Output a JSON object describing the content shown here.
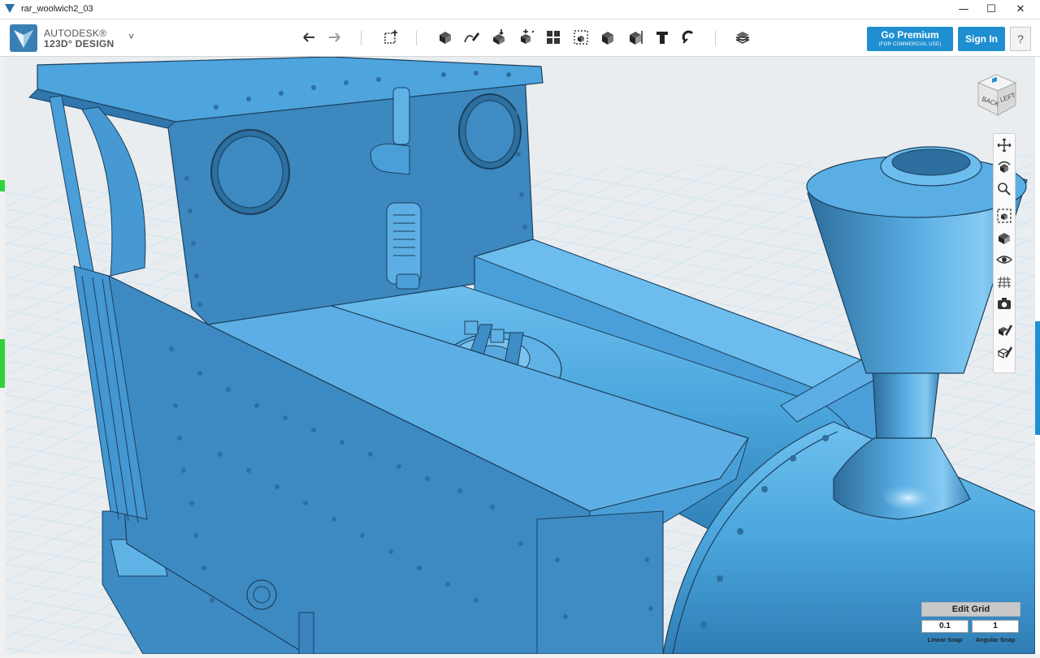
{
  "window": {
    "title": "rar_woolwich2_03",
    "controls": [
      "—",
      "☐",
      "✕"
    ]
  },
  "brand": {
    "line1": "AUTODESK®",
    "line2": "123D° DESIGN",
    "menu_chevron": "˅"
  },
  "toolbar": {
    "undo": "undo-icon",
    "redo": "redo-icon",
    "tools": [
      "transform-icon",
      "primitives-icon",
      "sketch-icon",
      "construct-icon",
      "modify-icon",
      "pattern-icon",
      "grouping-icon",
      "combine-icon",
      "measure-icon",
      "text-icon",
      "snap-icon",
      "material-icon"
    ],
    "premium_label": "Go Premium",
    "premium_sub": "(FOR COMMERCIAL USE)",
    "signin_label": "Sign In",
    "help_label": "?"
  },
  "viewcube": {
    "face_back": "BACK",
    "face_left": "LEFT"
  },
  "nav": [
    "pan-icon",
    "orbit-icon",
    "zoom-icon",
    "fit-icon",
    "view-mode-icon",
    "visibility-icon",
    "grid-toggle-icon",
    "screenshot-icon",
    "material-tool-icon",
    "outline-icon"
  ],
  "grid": {
    "edit_label": "Edit Grid",
    "linear_snap": "0.1",
    "angular_snap": "1",
    "linear_label": "Linear Snap",
    "angular_label": "Angular Snap"
  },
  "colors": {
    "accent": "#1f8fd1",
    "model": "#4b9fd6",
    "model_dark": "#2f6f9c",
    "model_light": "#7cc4ef",
    "grid_bg": "#e9edf0",
    "grid_line": "#a9d8ee"
  }
}
